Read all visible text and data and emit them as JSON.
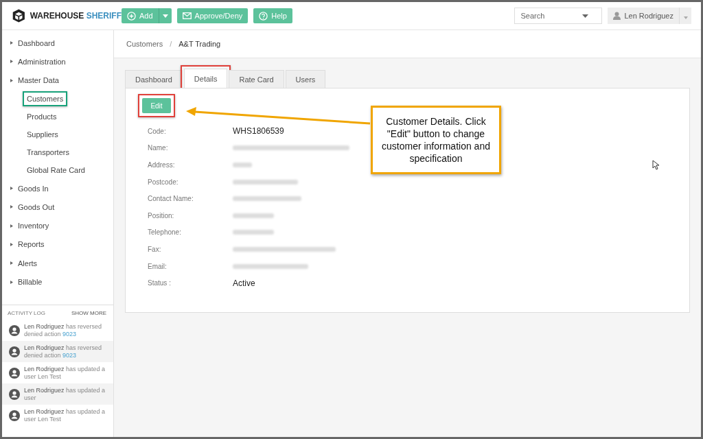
{
  "brand": {
    "name_first": "WAREHOUSE",
    "name_second": "SHERIFF"
  },
  "toolbar": [
    {
      "label": "Add",
      "kind": "split"
    },
    {
      "label": "Approve/Deny",
      "kind": "plain"
    },
    {
      "label": "Help",
      "kind": "plain"
    }
  ],
  "search": {
    "placeholder": "Search"
  },
  "user": {
    "name": "Len Rodriguez"
  },
  "sidebar": {
    "items": [
      {
        "label": "Dashboard",
        "highlighted": false
      },
      {
        "label": "Administration",
        "highlighted": false
      },
      {
        "label": "Master Data",
        "highlighted": false,
        "children": [
          {
            "label": "Customers",
            "highlighted": true
          },
          {
            "label": "Products",
            "highlighted": false
          },
          {
            "label": "Suppliers",
            "highlighted": false
          },
          {
            "label": "Transporters",
            "highlighted": false
          },
          {
            "label": "Global Rate Card",
            "highlighted": false
          }
        ]
      },
      {
        "label": "Goods In",
        "highlighted": false
      },
      {
        "label": "Goods Out",
        "highlighted": false
      },
      {
        "label": "Inventory",
        "highlighted": false
      },
      {
        "label": "Reports",
        "highlighted": false
      },
      {
        "label": "Alerts",
        "highlighted": false
      },
      {
        "label": "Billable",
        "highlighted": false
      }
    ]
  },
  "activity_log": {
    "title": "ACTIVITY LOG",
    "show_more": "SHOW MORE",
    "entries": [
      {
        "user": "Len Rodriguez",
        "text": "has reversed denied action",
        "link": "9023"
      },
      {
        "user": "Len Rodriguez",
        "text": "has reversed denied action",
        "link": "9023"
      },
      {
        "user": "Len Rodriguez",
        "text": "has updated a user Len Test"
      },
      {
        "user": "Len Rodriguez",
        "text": "has updated a user"
      },
      {
        "user": "Len Rodriguez",
        "text": "has updated a user Len Test"
      }
    ]
  },
  "breadcrumb": {
    "items": [
      "Customers",
      "A&T Trading"
    ],
    "separator": "/"
  },
  "tabs": [
    {
      "label": "Dashboard",
      "selected": false,
      "highlighted": false
    },
    {
      "label": "Details",
      "selected": true,
      "highlighted": true
    },
    {
      "label": "Rate Card",
      "selected": false,
      "highlighted": false
    },
    {
      "label": "Users",
      "selected": false,
      "highlighted": false
    }
  ],
  "edit_button": {
    "label": "Edit",
    "highlighted": true
  },
  "fields": [
    {
      "label": "Code:",
      "value": "WHS1806539",
      "redacted": false
    },
    {
      "label": "Name:",
      "redacted": true
    },
    {
      "label": "Address:",
      "redacted": true
    },
    {
      "label": "Postcode:",
      "redacted": true
    },
    {
      "label": "Contact Name:",
      "redacted": true
    },
    {
      "label": "Position:",
      "redacted": true
    },
    {
      "label": "Telephone:",
      "redacted": true
    },
    {
      "label": "Fax:",
      "redacted": true
    },
    {
      "label": "Email:",
      "redacted": true
    },
    {
      "label": "Status :",
      "value": "Active",
      "redacted": false
    }
  ],
  "callout": {
    "text": "Customer Details. Click \"Edit\" button to change customer information and specification"
  }
}
